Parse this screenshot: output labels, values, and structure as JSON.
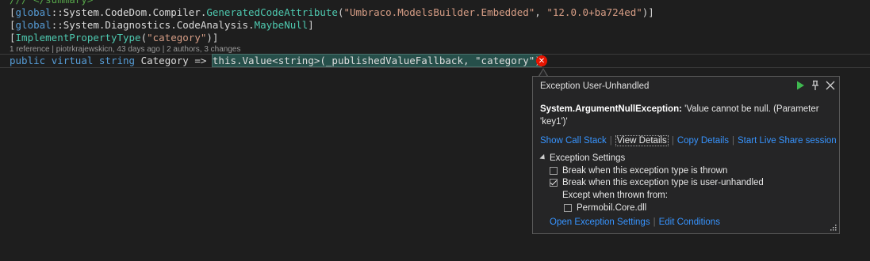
{
  "code": {
    "line0": [
      {
        "t": "/// </summary>",
        "c": "tk-cmt"
      }
    ],
    "line1": [
      {
        "t": "[",
        "c": "tk-punc"
      },
      {
        "t": "global",
        "c": "tk-kw"
      },
      {
        "t": "::System.CodeDom.Compiler.",
        "c": "tk-ident"
      },
      {
        "t": "GeneratedCodeAttribute",
        "c": "tk-type"
      },
      {
        "t": "(",
        "c": "tk-punc"
      },
      {
        "t": "\"Umbraco.ModelsBuilder.Embedded\"",
        "c": "tk-str"
      },
      {
        "t": ", ",
        "c": "tk-punc"
      },
      {
        "t": "\"12.0.0+ba724ed\"",
        "c": "tk-str"
      },
      {
        "t": ")]",
        "c": "tk-punc"
      }
    ],
    "line2": [
      {
        "t": "[",
        "c": "tk-punc"
      },
      {
        "t": "global",
        "c": "tk-kw"
      },
      {
        "t": "::System.Diagnostics.CodeAnalysis.",
        "c": "tk-ident"
      },
      {
        "t": "MaybeNull",
        "c": "tk-type"
      },
      {
        "t": "]",
        "c": "tk-punc"
      }
    ],
    "line3": [
      {
        "t": "[",
        "c": "tk-punc"
      },
      {
        "t": "ImplementPropertyType",
        "c": "tk-type"
      },
      {
        "t": "(",
        "c": "tk-punc"
      },
      {
        "t": "\"category\"",
        "c": "tk-str"
      },
      {
        "t": ")]",
        "c": "tk-punc"
      }
    ],
    "codelens": "1 reference | piotrkrajewskicn, 43 days ago | 2 authors, 3 changes",
    "line4": [
      {
        "t": "public ",
        "c": "tk-kw"
      },
      {
        "t": "virtual ",
        "c": "tk-kw"
      },
      {
        "t": "string ",
        "c": "tk-kw"
      },
      {
        "t": "Category ",
        "c": "tk-ident"
      },
      {
        "t": "=> ",
        "c": "tk-punc"
      },
      {
        "t": "this.Value<string>(_publishedValueFallback, \"category\")",
        "c": "tk-ident hl"
      },
      {
        "t": ";",
        "c": "tk-punc"
      }
    ]
  },
  "error_glyph": "✕",
  "popup": {
    "title": "Exception User-Unhandled",
    "exception_type": "System.ArgumentNullException:",
    "exception_message": " 'Value cannot be null. (Parameter 'key1')'",
    "links": {
      "show_call_stack": "Show Call Stack",
      "view_details": "View Details",
      "copy_details": "Copy Details",
      "live_share": "Start Live Share session"
    },
    "settings": {
      "header": "Exception Settings",
      "break_thrown": "Break when this exception type is thrown",
      "break_thrown_checked": false,
      "break_unhandled": "Break when this exception type is user-unhandled",
      "break_unhandled_checked": true,
      "except_when": "Except when thrown from:",
      "module": "Permobil.Core.dll",
      "module_checked": false
    },
    "bottom_links": {
      "open_settings": "Open Exception Settings",
      "edit_conditions": "Edit Conditions"
    }
  },
  "colors": {
    "editor_bg": "#1e1e1e",
    "keyword": "#569cd6",
    "type": "#4ec9b0",
    "string": "#d69d85",
    "link": "#3794ff",
    "error": "#e51400",
    "play": "#3fb950"
  }
}
